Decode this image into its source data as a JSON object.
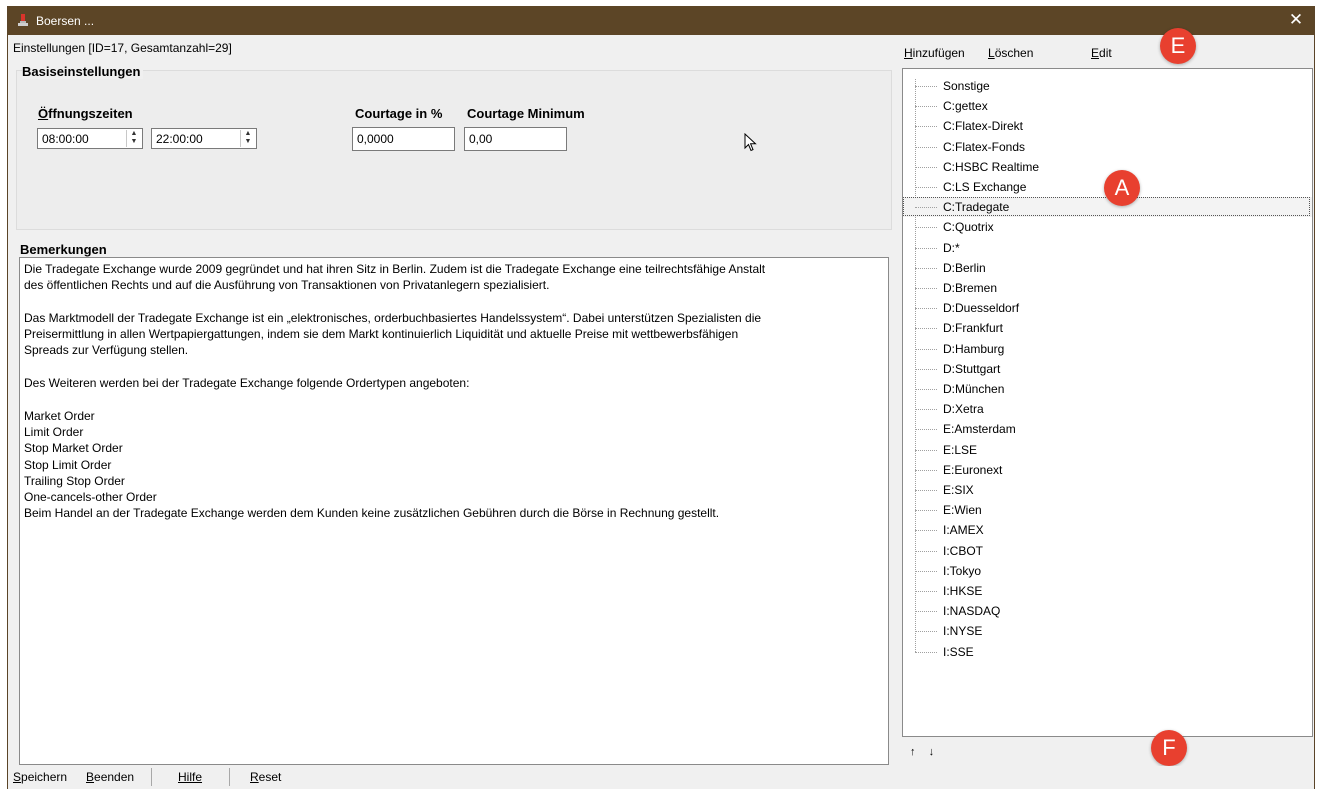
{
  "window": {
    "title": "Boersen ...",
    "close_symbol": "✕"
  },
  "header": {
    "info": "Einstellungen [ID=17, Gesamtanzahl=29]"
  },
  "basis": {
    "title": "Basiseinstellungen",
    "oeffnungszeiten_label": "Öffnungszeiten",
    "oeffnungszeiten_prefix": "Ö",
    "oeffnungszeiten_rest": "ffnungszeiten",
    "open_time": "08:00:00",
    "close_time": "22:00:00",
    "courtage_pct_label": "Courtage in %",
    "courtage_pct_value": "0,0000",
    "courtage_min_label": "Courtage Minimum",
    "courtage_min_value": "0,00"
  },
  "bemerkungen": {
    "title": "Bemerkungen",
    "lines": [
      "Die Tradegate Exchange wurde 2009 gegründet und hat ihren Sitz in Berlin. Zudem ist die Tradegate Exchange eine teilrechtsfähige Anstalt",
      "des öffentlichen Rechts und auf die Ausführung von Transaktionen von Privatanlegern spezialisiert.",
      "",
      "Das Marktmodell der Tradegate Exchange ist ein „elektronisches, orderbuchbasiertes Handelssystem“. Dabei unterstützen Spezialisten die",
      "Preisermittlung in allen Wertpapiergattungen, indem sie dem Markt kontinuierlich Liquidität und aktuelle Preise mit wettbewerbsfähigen",
      "Spreads zur Verfügung stellen.",
      "",
      "Des Weiteren werden bei der Tradegate Exchange folgende Ordertypen angeboten:",
      "",
      "Market Order",
      "Limit Order",
      "Stop Market Order",
      "Stop Limit Order",
      "Trailing Stop Order",
      "One-cancels-other Order",
      "Beim Handel an der Tradegate Exchange werden dem Kunden keine zusätzlichen Gebühren durch die Börse in Rechnung gestellt."
    ]
  },
  "right_menu": {
    "add": "Hinzufügen",
    "delete": "Löschen",
    "edit": "Edit"
  },
  "tree": {
    "selected": "C:Tradegate",
    "items": [
      "Sonstige",
      "C:gettex",
      "C:Flatex-Direkt",
      "C:Flatex-Fonds",
      "C:HSBC Realtime",
      "C:LS Exchange",
      "C:Tradegate",
      "C:Quotrix",
      "D:*",
      "D:Berlin",
      "D:Bremen",
      "D:Duesseldorf",
      "D:Frankfurt",
      "D:Hamburg",
      "D:Stuttgart",
      "D:München",
      "D:Xetra",
      "E:Amsterdam",
      "E:LSE",
      "E:Euronext",
      "E:SIX",
      "E:Wien",
      "I:AMEX",
      "I:CBOT",
      "I:Tokyo",
      "I:HKSE",
      "I:NASDAQ",
      "I:NYSE",
      "I:SSE"
    ]
  },
  "tree_arrows": {
    "up": "↑",
    "down": "↓"
  },
  "badges": {
    "e": "E",
    "a": "A",
    "f": "F"
  },
  "bottom": {
    "save": "Speichern",
    "quit": "Beenden",
    "help": "Hilfe",
    "reset": "Reset"
  },
  "colors": {
    "titlebar": "#5c4526",
    "badge": "#e8402f",
    "selection": "#f3f3f3"
  }
}
